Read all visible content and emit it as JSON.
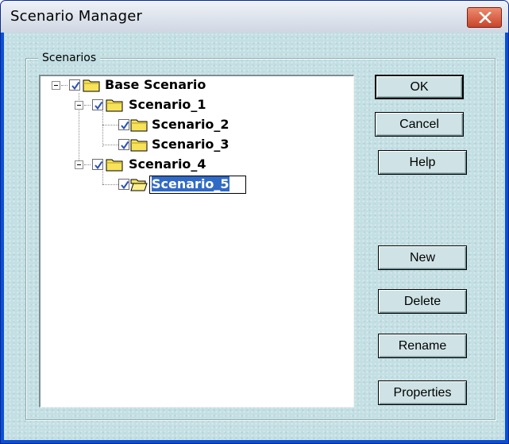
{
  "window": {
    "title": "Scenario Manager"
  },
  "group": {
    "label": "Scenarios"
  },
  "tree": {
    "nodes": [
      {
        "label": "Base Scenario",
        "checked": true,
        "expanded": true
      },
      {
        "label": "Scenario_1",
        "checked": true,
        "expanded": true
      },
      {
        "label": "Scenario_2",
        "checked": true
      },
      {
        "label": "Scenario_3",
        "checked": true
      },
      {
        "label": "Scenario_4",
        "checked": true,
        "expanded": true
      },
      {
        "label": "Scenario_5",
        "checked": true,
        "editing": true,
        "open_folder": true
      }
    ]
  },
  "buttons": {
    "ok": "OK",
    "cancel": "Cancel",
    "help": "Help",
    "new": "New",
    "delete": "Delete",
    "rename": "Rename",
    "properties": "Properties"
  },
  "colors": {
    "titlebar": "#e3e8f0",
    "client": "#c3dfe3",
    "selection": "#316ac5",
    "close": "#d9593c"
  }
}
